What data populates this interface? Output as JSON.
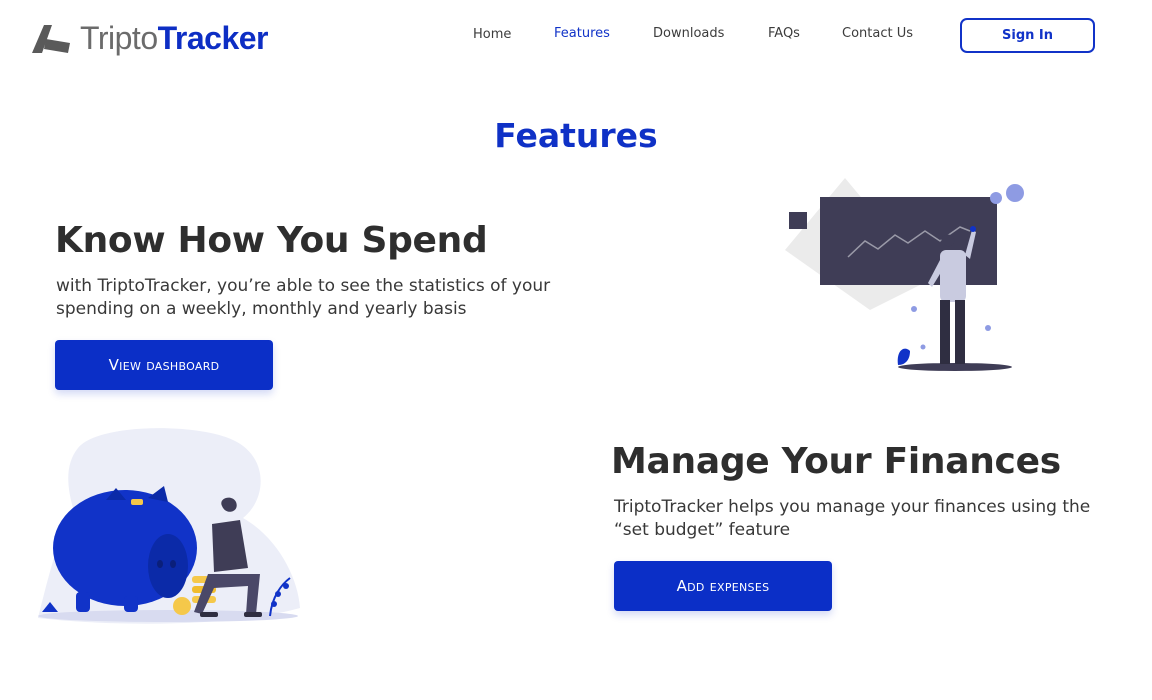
{
  "header": {
    "logo": {
      "text_light": "Tripto",
      "text_bold": "Tracker"
    },
    "nav": [
      {
        "label": "Home",
        "active": false
      },
      {
        "label": "Features",
        "active": true
      },
      {
        "label": "Downloads",
        "active": false
      },
      {
        "label": "FAQs",
        "active": false
      },
      {
        "label": "Contact Us",
        "active": false
      }
    ],
    "signin_label": "Sign In"
  },
  "page_title": "Features",
  "features": [
    {
      "heading": "Know How You Spend",
      "description": "with TriptoTracker, you’re able to see the statistics of your spending on a weekly, monthly and yearly basis",
      "button_label": "View dashboard",
      "illustration": "person-presenting-chart-illustration"
    },
    {
      "heading": "Manage Your Finances",
      "description": "TriptoTracker helps you manage your finances using the “set budget” feature",
      "button_label": "Add expenses",
      "illustration": "piggy-bank-savings-illustration"
    }
  ],
  "colors": {
    "brand_blue": "#0b2fc7",
    "text_dark": "#2e2e2e",
    "illustration_dark": "#3f3d56",
    "illustration_light": "#eceef8"
  }
}
